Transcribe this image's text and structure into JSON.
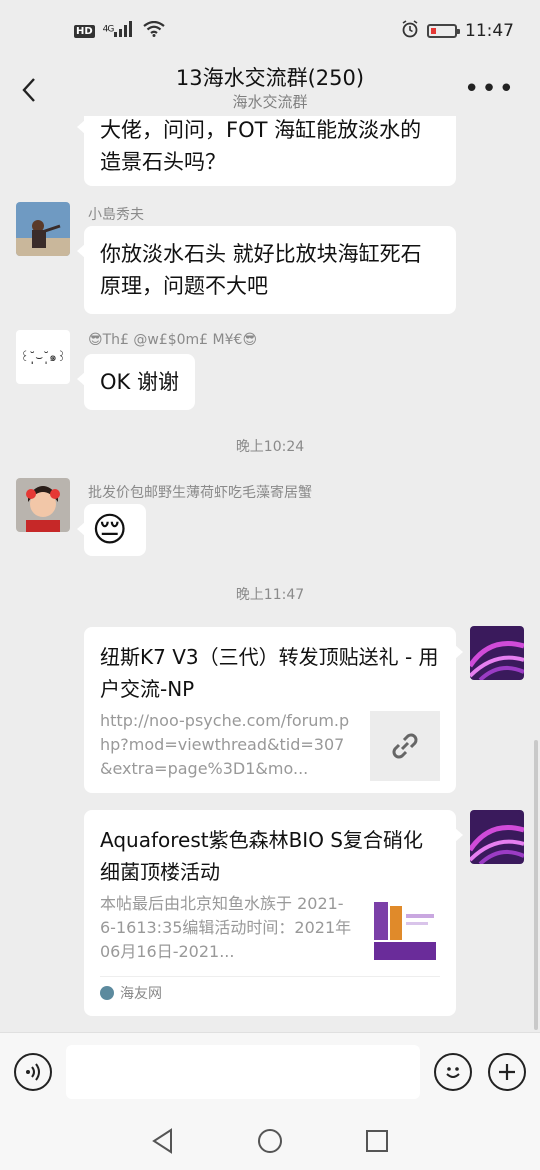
{
  "status": {
    "left_badge": "HD",
    "network": "4G",
    "time": "11:47"
  },
  "header": {
    "title": "13海水交流群(250)",
    "subtitle": "海水交流群",
    "more": "•••"
  },
  "messages": [
    {
      "text": "大佬，问问，FOT 海缸能放淡水的造景石头吗？"
    },
    {
      "sender": "小島秀夫",
      "text": "你放淡水石头 就好比放块海缸死石原理，问题不大吧"
    },
    {
      "avatar_text": "꒰˘̩̩̩⌣˘̩̩̩๑꒱",
      "sender": "😎Th£ @w£$0m£ M¥€😎",
      "text": "OK 谢谢"
    },
    {
      "sender": "批发价包邮野生薄荷虾吃毛藻寄居蟹",
      "text": "😔"
    }
  ],
  "time_separators": [
    "晚上10:24",
    "晚上11:47"
  ],
  "link_cards": [
    {
      "title": "纽斯K7 V3（三代）转发顶贴送礼 - 用户交流-NP",
      "desc": "http://noo-psyche.com/forum.php?mod=viewthread&tid=307&extra=page%3D1&mo...",
      "thumb_icon": "link-icon"
    },
    {
      "title": "Aquaforest紫色森林BIO S复合硝化细菌顶楼活动",
      "desc": "本帖最后由北京知鱼水族于 2021-6-1613:35编辑活动时间：2021年06月16日-2021...",
      "source": "海友网"
    }
  ],
  "colors": {
    "background": "#ededed",
    "bubble": "#ffffff",
    "meta_text": "#8a8a8a"
  }
}
